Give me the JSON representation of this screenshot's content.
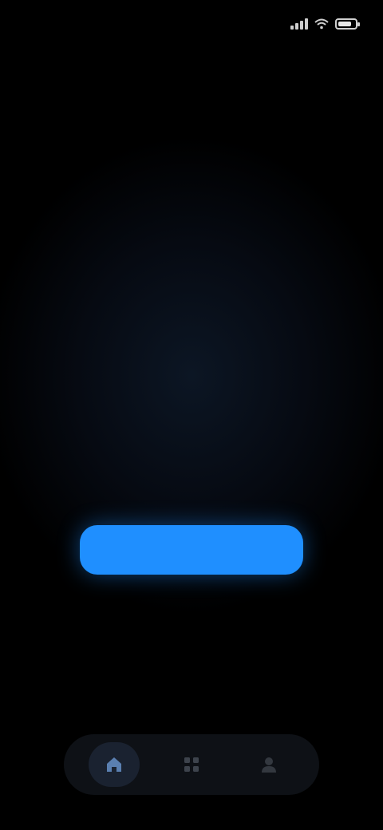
{
  "status_bar": {
    "time": "",
    "battery_level": 0.8
  },
  "header": {
    "title": ""
  },
  "hero": {
    "headline": "",
    "subheadline": "",
    "description": ""
  },
  "cta": {
    "label": ""
  },
  "bottom_nav": {
    "items": [
      {
        "icon": "home-icon",
        "active": true
      },
      {
        "icon": "grid-icon",
        "active": false
      },
      {
        "icon": "profile-icon",
        "active": false
      }
    ]
  },
  "colors": {
    "background": "#000000",
    "accent": "#1f8fff",
    "headline": "#4d8ee0",
    "nav_background": "#0e1116"
  }
}
